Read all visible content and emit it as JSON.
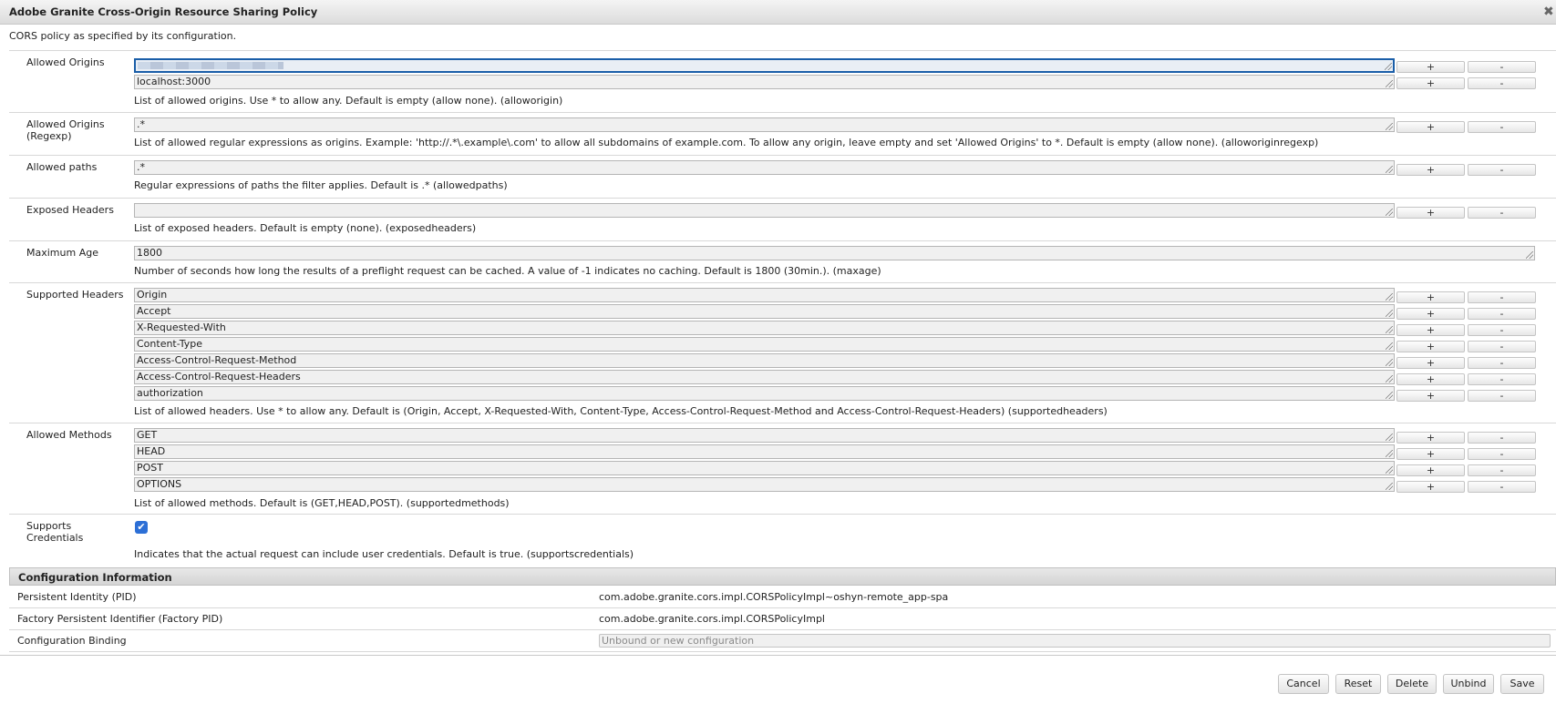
{
  "window": {
    "title": "Adobe Granite Cross-Origin Resource Sharing Policy",
    "close_icon": "✖"
  },
  "description": "CORS policy as specified by its configuration.",
  "buttons": {
    "plus": "+",
    "minus": "-"
  },
  "sections": {
    "allowed_origins": {
      "label": "Allowed Origins",
      "values": [
        "",
        "localhost:3000"
      ],
      "help": "List of allowed origins. Use * to allow any. Default is empty (allow none). (alloworigin)"
    },
    "allowed_origins_regexp": {
      "label": "Allowed Origins (Regexp)",
      "values": [
        ".*"
      ],
      "help": "List of allowed regular expressions as origins. Example: 'http://.*\\.example\\.com' to allow all subdomains of example.com. To allow any origin, leave empty and set 'Allowed Origins' to *. Default is empty (allow none). (alloworiginregexp)"
    },
    "allowed_paths": {
      "label": "Allowed paths",
      "values": [
        ".*"
      ],
      "help": "Regular expressions of paths the filter applies. Default is .* (allowedpaths)"
    },
    "exposed_headers": {
      "label": "Exposed Headers",
      "values": [
        ""
      ],
      "help": "List of exposed headers. Default is empty (none). (exposedheaders)"
    },
    "maximum_age": {
      "label": "Maximum Age",
      "value": "1800",
      "help": "Number of seconds how long the results of a preflight request can be cached. A value of -1 indicates no caching. Default is 1800 (30min.). (maxage)"
    },
    "supported_headers": {
      "label": "Supported Headers",
      "values": [
        "Origin",
        "Accept",
        "X-Requested-With",
        "Content-Type",
        "Access-Control-Request-Method",
        "Access-Control-Request-Headers",
        "authorization"
      ],
      "help": "List of allowed headers. Use * to allow any. Default is (Origin, Accept, X-Requested-With, Content-Type, Access-Control-Request-Method and Access-Control-Request-Headers) (supportedheaders)"
    },
    "allowed_methods": {
      "label": "Allowed Methods",
      "values": [
        "GET",
        "HEAD",
        "POST",
        "OPTIONS"
      ],
      "help": "List of allowed methods. Default is (GET,HEAD,POST). (supportedmethods)"
    },
    "supports_credentials": {
      "label": "Supports Credentials",
      "checked": true,
      "check_glyph": "✔",
      "help": "Indicates that the actual request can include user credentials. Default is true. (supportscredentials)"
    }
  },
  "config_info": {
    "header": "Configuration Information",
    "pid_label": "Persistent Identity (PID)",
    "pid_value": "com.adobe.granite.cors.impl.CORSPolicyImpl~oshyn-remote_app-spa",
    "factory_pid_label": "Factory Persistent Identifier (Factory PID)",
    "factory_pid_value": "com.adobe.granite.cors.impl.CORSPolicyImpl",
    "binding_label": "Configuration Binding",
    "binding_placeholder": "Unbound or new configuration"
  },
  "footer": {
    "cancel": "Cancel",
    "reset": "Reset",
    "delete": "Delete",
    "unbind": "Unbind",
    "save": "Save"
  }
}
